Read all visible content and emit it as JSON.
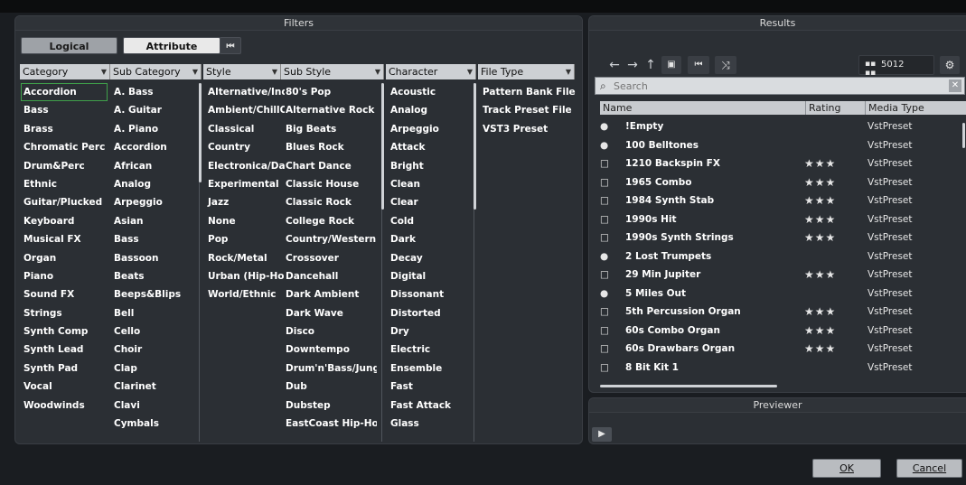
{
  "filters": {
    "title": "Filters",
    "mode_logical": "Logical",
    "mode_attribute": "Attribute",
    "reset_icon": "⏮",
    "columns": [
      {
        "header": "Category",
        "items": [
          "Accordion",
          "Bass",
          "Brass",
          "Chromatic Perc",
          "Drum&Perc",
          "Ethnic",
          "Guitar/Plucked",
          "Keyboard",
          "Musical FX",
          "Organ",
          "Piano",
          "Sound FX",
          "Strings",
          "Synth Comp",
          "Synth Lead",
          "Synth Pad",
          "Vocal",
          "Woodwinds"
        ]
      },
      {
        "header": "Sub Category",
        "items": [
          "A. Bass",
          "A. Guitar",
          "A. Piano",
          "Accordion",
          "African",
          "Analog",
          "Arpeggio",
          "Asian",
          "Bass",
          "Bassoon",
          "Beats",
          "Beeps&Blips",
          "Bell",
          "Cello",
          "Choir",
          "Clap",
          "Clarinet",
          "Clavi",
          "Cymbals"
        ]
      },
      {
        "header": "Style",
        "items": [
          "Alternative/Indie",
          "Ambient/ChillOut",
          "Classical",
          "Country",
          "Electronica/Dance",
          "Experimental",
          "Jazz",
          "None",
          "Pop",
          "Rock/Metal",
          "Urban (Hip-Hop / R&B)",
          "World/Ethnic"
        ]
      },
      {
        "header": "Sub Style",
        "items": [
          "80's Pop",
          "Alternative Rock",
          "Big Beats",
          "Blues Rock",
          "Chart Dance",
          "Classic House",
          "Classic Rock",
          "College Rock",
          "Country/Western",
          "Crossover",
          "Dancehall",
          "Dark Ambient",
          "Dark Wave",
          "Disco",
          "Downtempo",
          "Drum'n'Bass/Jungle",
          "Dub",
          "Dubstep",
          "EastCoast Hip-Hop"
        ]
      },
      {
        "header": "Character",
        "items": [
          "Acoustic",
          "Analog",
          "Arpeggio",
          "Attack",
          "Bright",
          "Clean",
          "Clear",
          "Cold",
          "Dark",
          "Decay",
          "Digital",
          "Dissonant",
          "Distorted",
          "Dry",
          "Electric",
          "Ensemble",
          "Fast",
          "Fast Attack",
          "Glass"
        ]
      },
      {
        "header": "File Type",
        "items": [
          "Pattern Bank File",
          "Track Preset File",
          "VST3 Preset"
        ]
      }
    ]
  },
  "results": {
    "title": "Results",
    "count": "5012",
    "search_placeholder": "Search",
    "headers": {
      "name": "Name",
      "rating": "Rating",
      "media_type": "Media Type"
    },
    "rows": [
      {
        "icon": "●",
        "name": "!Empty",
        "rating": "",
        "type": "VstPreset"
      },
      {
        "icon": "●",
        "name": "100 Belltones",
        "rating": "",
        "type": "VstPreset"
      },
      {
        "icon": "□",
        "name": "1210 Backspin FX",
        "rating": "★★★",
        "type": "VstPreset"
      },
      {
        "icon": "□",
        "name": "1965 Combo",
        "rating": "★★★",
        "type": "VstPreset"
      },
      {
        "icon": "□",
        "name": "1984 Synth Stab",
        "rating": "★★★",
        "type": "VstPreset"
      },
      {
        "icon": "□",
        "name": "1990s Hit",
        "rating": "★★★",
        "type": "VstPreset"
      },
      {
        "icon": "□",
        "name": "1990s Synth Strings",
        "rating": "★★★",
        "type": "VstPreset"
      },
      {
        "icon": "●",
        "name": "2 Lost Trumpets",
        "rating": "",
        "type": "VstPreset"
      },
      {
        "icon": "□",
        "name": "29 Min Jupiter",
        "rating": "★★★",
        "type": "VstPreset"
      },
      {
        "icon": "●",
        "name": "5 Miles Out",
        "rating": "",
        "type": "VstPreset"
      },
      {
        "icon": "□",
        "name": "5th Percussion Organ",
        "rating": "★★★",
        "type": "VstPreset"
      },
      {
        "icon": "□",
        "name": "60s Combo Organ",
        "rating": "★★★",
        "type": "VstPreset"
      },
      {
        "icon": "□",
        "name": "60s Drawbars Organ",
        "rating": "★★★",
        "type": "VstPreset"
      },
      {
        "icon": "□",
        "name": "8 Bit Kit 1",
        "rating": "",
        "type": "VstPreset"
      }
    ]
  },
  "previewer": {
    "title": "Previewer"
  },
  "dialog": {
    "ok": "OK",
    "cancel": "Cancel"
  }
}
